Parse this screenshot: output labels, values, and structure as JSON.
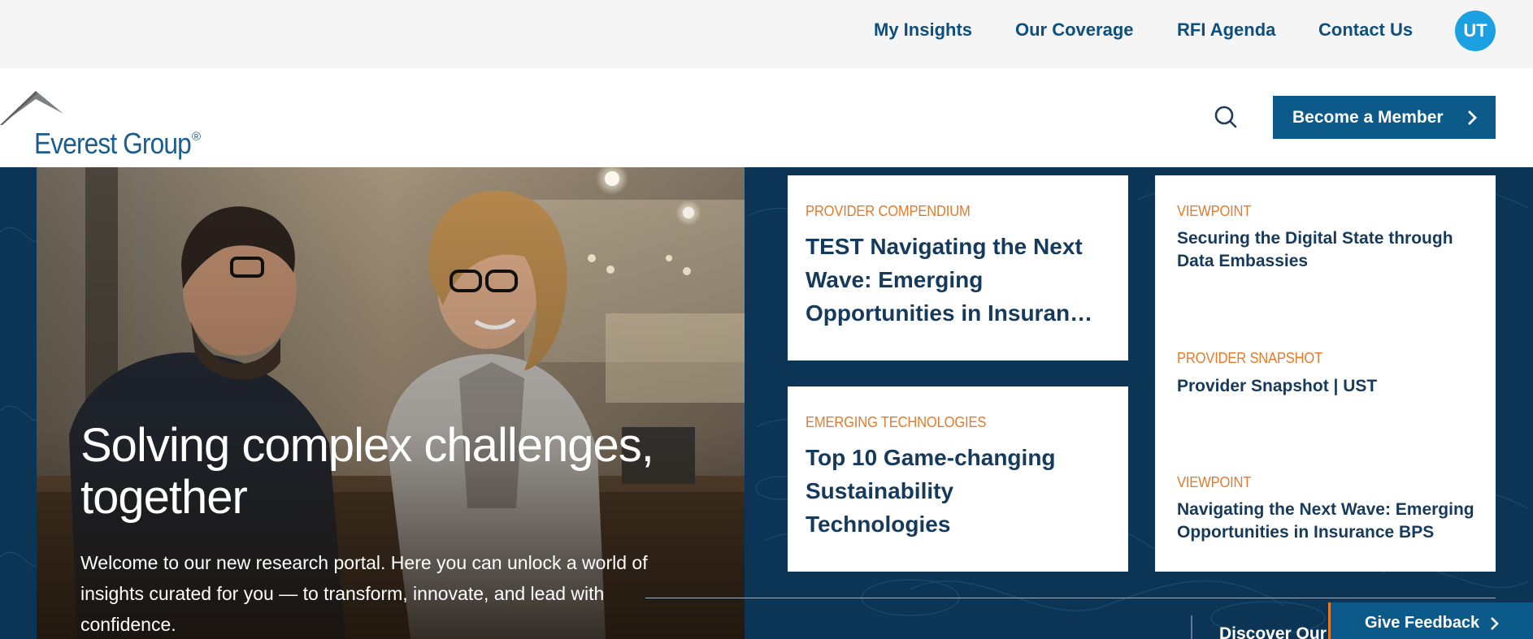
{
  "utility_nav": {
    "items": [
      {
        "label": "My Insights"
      },
      {
        "label": "Our Coverage"
      },
      {
        "label": "RFI Agenda"
      },
      {
        "label": "Contact Us"
      }
    ],
    "avatar_initials": "UT"
  },
  "header": {
    "logo_text": "Everest Group",
    "logo_mark": "®",
    "search_icon": "search-icon",
    "member_button": "Become a Member"
  },
  "hero": {
    "title": "Solving complex challenges, together",
    "subtitle": "Welcome to our new research portal. Here you can unlock a world of insights curated for you — to transform, innovate, and lead with confidence."
  },
  "cards": {
    "featured": [
      {
        "category": "PROVIDER COMPENDIUM",
        "title": "TEST Navigating the Next Wave: Emerging Opportunities in Insuran…"
      },
      {
        "category": "EMERGING TECHNOLOGIES",
        "title": "Top 10 Game-changing Sustainability Technologies"
      }
    ],
    "list": [
      {
        "category": "VIEWPOINT",
        "title": "Securing the Digital State through Data Embassies"
      },
      {
        "category": "PROVIDER SNAPSHOT",
        "title": "Provider Snapshot | UST"
      },
      {
        "category": "VIEWPOINT",
        "title": "Navigating the Next Wave: Emerging Opportunities in Insurance BPS"
      }
    ]
  },
  "footer_bar": {
    "discover_label": "Discover Our",
    "feedback_button": "Give Feedback"
  },
  "colors": {
    "nav_text": "#0d4f7e",
    "accent_blue": "#0c5a8a",
    "avatar": "#1ba1e2",
    "hero_bg": "#0c3555",
    "category_orange": "#e37a2c",
    "card_title": "#163a5c"
  }
}
